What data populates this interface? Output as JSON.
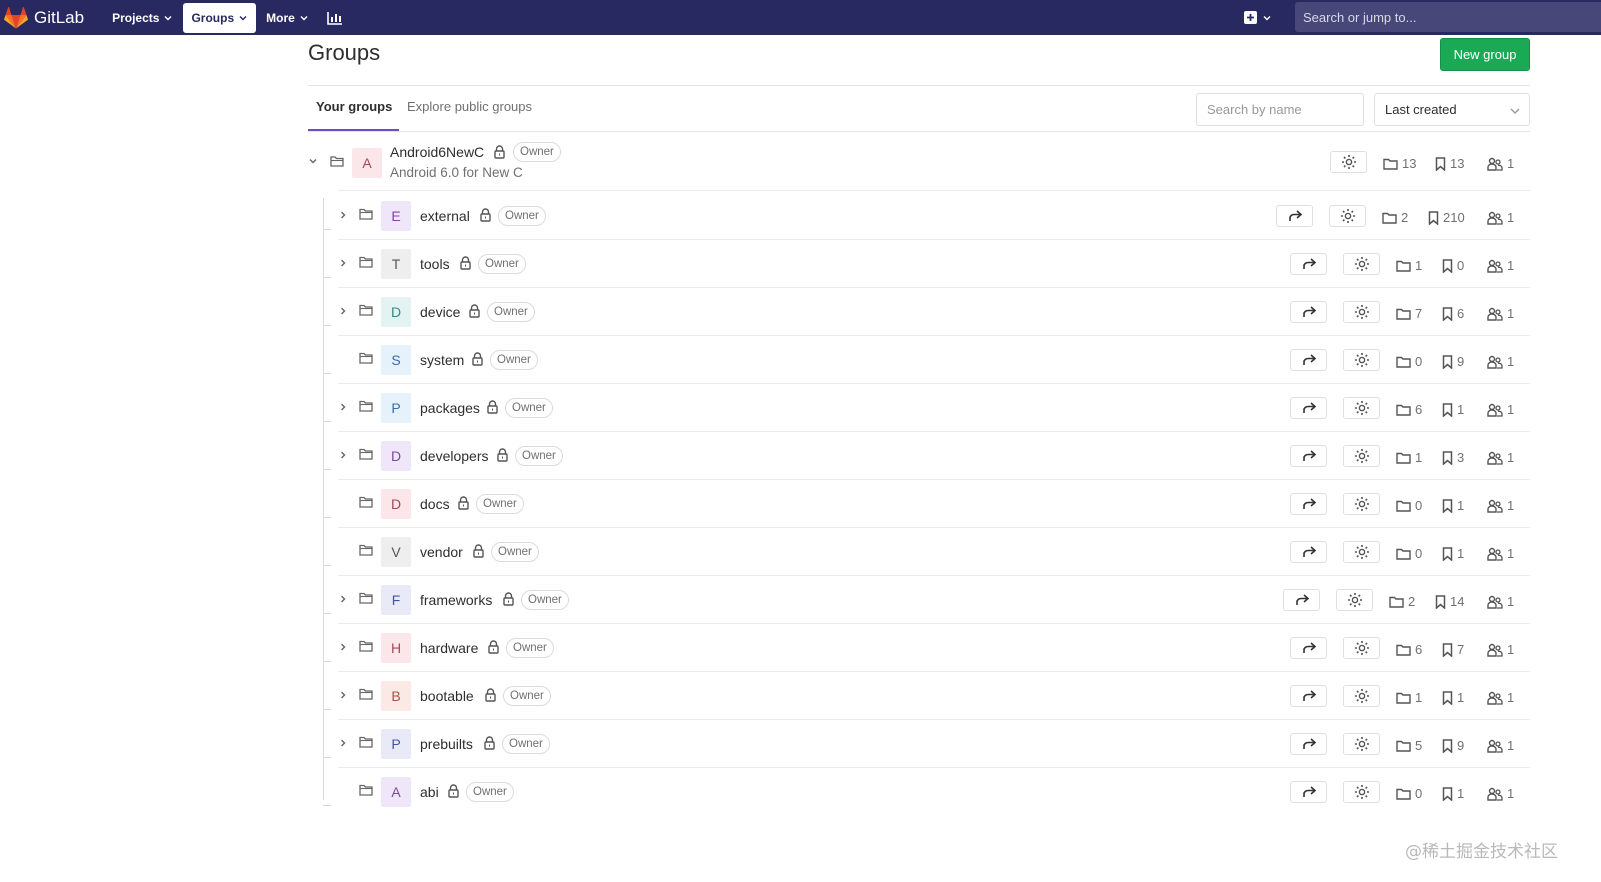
{
  "navbar": {
    "brand": "GitLab",
    "projects_label": "Projects",
    "groups_label": "Groups",
    "more_label": "More",
    "search_placeholder": "Search or jump to..."
  },
  "header": {
    "title": "Groups",
    "new_group_label": "New group"
  },
  "tabs": {
    "your_groups": "Your groups",
    "explore": "Explore public groups"
  },
  "filters": {
    "search_placeholder": "Search by name",
    "sort_label": "Last created"
  },
  "root_group": {
    "letter": "A",
    "name": "Android6NewC",
    "role": "Owner",
    "description": "Android 6.0 for New C",
    "subgroups": "13",
    "projects": "13",
    "members": "1",
    "avatar_bg": "#fbe6ea",
    "avatar_fg": "#a04a5a"
  },
  "groups": [
    {
      "letter": "E",
      "name": "external",
      "role": "Owner",
      "subgroups": "2",
      "projects": "210",
      "members": "1",
      "expandable": true,
      "avatar_bg": "#f0e6fa",
      "avatar_fg": "#7b4aa0"
    },
    {
      "letter": "T",
      "name": "tools",
      "role": "Owner",
      "subgroups": "1",
      "projects": "0",
      "members": "1",
      "expandable": true,
      "avatar_bg": "#eeeeee",
      "avatar_fg": "#555555"
    },
    {
      "letter": "D",
      "name": "device",
      "role": "Owner",
      "subgroups": "7",
      "projects": "6",
      "members": "1",
      "expandable": true,
      "avatar_bg": "#e2f3f2",
      "avatar_fg": "#3a8a84"
    },
    {
      "letter": "S",
      "name": "system",
      "role": "Owner",
      "subgroups": "0",
      "projects": "9",
      "members": "1",
      "expandable": false,
      "avatar_bg": "#e5f1fb",
      "avatar_fg": "#3a6fa0"
    },
    {
      "letter": "P",
      "name": "packages",
      "role": "Owner",
      "subgroups": "6",
      "projects": "1",
      "members": "1",
      "expandable": true,
      "avatar_bg": "#e5f1fb",
      "avatar_fg": "#3a6fa0"
    },
    {
      "letter": "D",
      "name": "developers",
      "role": "Owner",
      "subgroups": "1",
      "projects": "3",
      "members": "1",
      "expandable": true,
      "avatar_bg": "#f0e6fa",
      "avatar_fg": "#7b4aa0"
    },
    {
      "letter": "D",
      "name": "docs",
      "role": "Owner",
      "subgroups": "0",
      "projects": "1",
      "members": "1",
      "expandable": false,
      "avatar_bg": "#fbe6ea",
      "avatar_fg": "#a04a5a"
    },
    {
      "letter": "V",
      "name": "vendor",
      "role": "Owner",
      "subgroups": "0",
      "projects": "1",
      "members": "1",
      "expandable": false,
      "avatar_bg": "#eeeeee",
      "avatar_fg": "#555555"
    },
    {
      "letter": "F",
      "name": "frameworks",
      "role": "Owner",
      "subgroups": "2",
      "projects": "14",
      "members": "1",
      "expandable": true,
      "avatar_bg": "#e8eaf8",
      "avatar_fg": "#4a52a0"
    },
    {
      "letter": "H",
      "name": "hardware",
      "role": "Owner",
      "subgroups": "6",
      "projects": "7",
      "members": "1",
      "expandable": true,
      "avatar_bg": "#fbe6ea",
      "avatar_fg": "#a04a5a"
    },
    {
      "letter": "B",
      "name": "bootable",
      "role": "Owner",
      "subgroups": "1",
      "projects": "1",
      "members": "1",
      "expandable": true,
      "avatar_bg": "#fbe9e5",
      "avatar_fg": "#a0584a"
    },
    {
      "letter": "P",
      "name": "prebuilts",
      "role": "Owner",
      "subgroups": "5",
      "projects": "9",
      "members": "1",
      "expandable": true,
      "avatar_bg": "#e8eaf8",
      "avatar_fg": "#4a52a0"
    },
    {
      "letter": "A",
      "name": "abi",
      "role": "Owner",
      "subgroups": "0",
      "projects": "1",
      "members": "1",
      "expandable": false,
      "avatar_bg": "#f0e6fa",
      "avatar_fg": "#7b4aa0"
    }
  ],
  "watermark": "@稀土掘金技术社区",
  "colors": {
    "navbar": "#292961",
    "primary_button": "#1aaa55",
    "tab_active": "#6b4fbb"
  }
}
